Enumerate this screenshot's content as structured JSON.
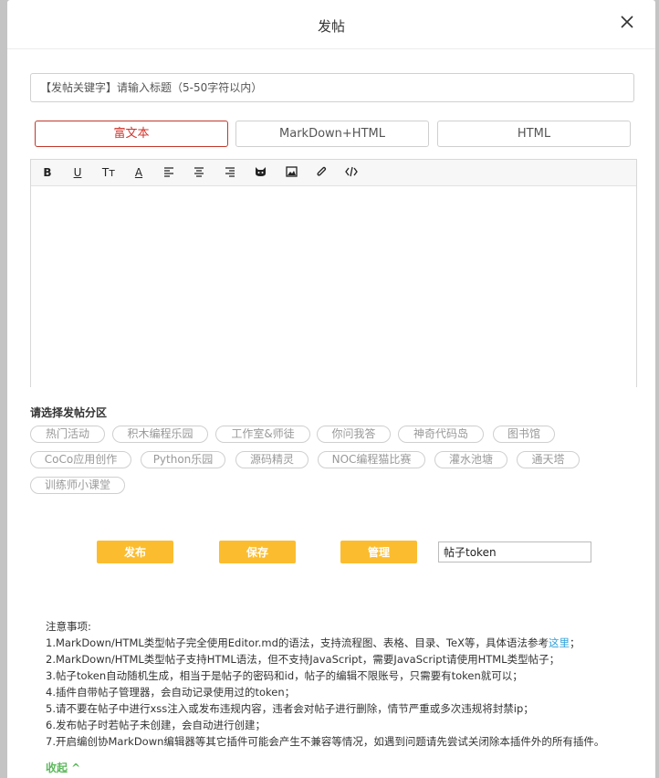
{
  "dialog": {
    "title": "发帖",
    "close_glyph": "×"
  },
  "title_input": {
    "placeholder": "【发帖关键字】请输入标题（5-50字符以内）",
    "value": ""
  },
  "editor_modes": [
    {
      "label": "富文本",
      "active": true
    },
    {
      "label": "MarkDown+HTML",
      "active": false
    },
    {
      "label": "HTML",
      "active": false
    }
  ],
  "toolbar": {
    "bold": "B",
    "underline": "U",
    "font_size": "Tт",
    "font_color": "A",
    "icons": [
      "bold-icon",
      "underline-icon",
      "font-size-icon",
      "font-color-icon",
      "align-left-icon",
      "align-center-icon",
      "align-right-icon",
      "emoji-cat-icon",
      "image-icon",
      "attachment-icon",
      "code-icon"
    ]
  },
  "category": {
    "title": "请选择发帖分区",
    "items": [
      "热门活动",
      "积木编程乐园",
      "工作室&师徒",
      "你问我答",
      "神奇代码岛",
      "图书馆",
      "CoCo应用创作",
      "Python乐园",
      "源码精灵",
      "NOC编程猫比赛",
      "灌水池塘",
      "通天塔",
      "训练师小课堂"
    ]
  },
  "actions": {
    "publish": "发布",
    "save": "保存",
    "manage": "管理",
    "token_placeholder": "帖子token"
  },
  "notes": {
    "heading": "注意事项:",
    "line1_a": "1.MarkDown/HTML类型帖子完全使用Editor.md的语法，支持流程图、表格、目录、TeX等，具体语法参考",
    "line1_link": "这里",
    "line1_b": "；",
    "line2": "2.MarkDown/HTML类型帖子支持HTML语法，但不支持JavaScript，需要JavaScript请使用HTML类型帖子；",
    "line3": "3.帖子token自动随机生成，相当于是帖子的密码和id，帖子的编辑不限账号，只需要有token就可以；",
    "line4": "4.插件自带帖子管理器，会自动记录使用过的token；",
    "line5": "5.请不要在帖子中进行xss注入或发布违规内容，违者会对帖子进行删除，情节严重或多次违规将封禁ip；",
    "line6": "6.发布帖子时若帖子未创建，会自动进行创建；",
    "line7": "7.开启编创协MarkDown编辑器等其它插件可能会产生不兼容等情况，如遇到问题请先尝试关闭除本插件外的所有插件。"
  },
  "collapse_label": "收起 ^",
  "colors": {
    "accent_red": "#d0342c",
    "button_yellow": "#fbbd2f",
    "link_blue": "#2fa0d8",
    "collapse_green": "#5cb85c"
  }
}
